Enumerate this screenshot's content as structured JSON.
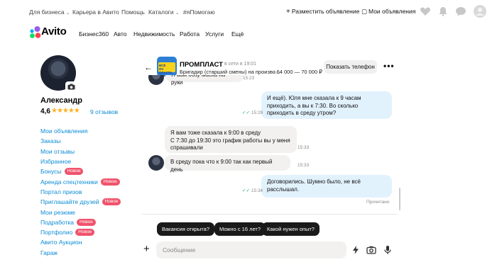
{
  "topbar": {
    "links": [
      "Для бизнеса",
      "Карьера в Авито",
      "Помощь",
      "Каталоги",
      "#яПомогаю"
    ],
    "post_ad": "Разместить объявление",
    "my_ads": "Мои объявления"
  },
  "header": {
    "logo_text": "Avito",
    "nav": [
      "Бизнес360",
      "Авто",
      "Недвижимость",
      "Работа",
      "Услуги",
      "Ещё"
    ]
  },
  "profile": {
    "name": "Александр",
    "rating": "4,6",
    "stars": "★★★★★",
    "rating_value": 4.6,
    "reviews": "9 отзывов",
    "menu": [
      {
        "label": "Мои объявления",
        "badge": ""
      },
      {
        "label": "Заказы",
        "badge": ""
      },
      {
        "label": "Мои отзывы",
        "badge": ""
      },
      {
        "label": "Избранное",
        "badge": ""
      },
      {
        "label": "Бонусы",
        "badge": "Новое"
      },
      {
        "label": "Аренда спецтехники",
        "badge": "Новое"
      },
      {
        "label": "Портал призов",
        "badge": ""
      },
      {
        "label": "Приглашайте друзей",
        "badge": "Новое"
      },
      {
        "label": "Мои резюме",
        "badge": ""
      },
      {
        "label": "Подработка",
        "badge": "Новое"
      },
      {
        "label": "Портфолио",
        "badge": "Новое"
      },
      {
        "label": "Авито Аукцион",
        "badge": ""
      },
      {
        "label": "Гараж",
        "badge": ""
      }
    ]
  },
  "chat": {
    "shop_name": "ПРОМПЛАСТ",
    "status": "в сети в 19:01",
    "job": "Бригадир (старший смены) на произво...",
    "salary": "· 64 000 — 70 000 ₽",
    "phone_button": "Показать телефон",
    "messages": [
      {
        "dir": "in",
        "text": "Я вам обзу маска на руки",
        "time": "15:23"
      },
      {
        "dir": "out",
        "text": "И ещё). Юля мне сказала к 9 часам приходить, а вы к 7:30. Во сколько приходить в среду утром?",
        "time": "15:29"
      },
      {
        "dir": "in",
        "text": "Я вам тоже сказала к 9:00 в среду\nС 7:30 до 19:30 это график работы вы у меня спрашивали",
        "time": "15:33"
      },
      {
        "dir": "in",
        "text": "В среду пока что к 9:00 так как первый день",
        "time": "15:33"
      },
      {
        "dir": "out",
        "text": "Договорились. Шумно было, не всё расслышал.",
        "time": "15:34"
      }
    ],
    "read_status": "Прочитано",
    "suggestions": [
      "Вакансия открыта?",
      "Можно с 16 лет?",
      "Какой нужен опыт?"
    ],
    "input_placeholder": "Сообщение"
  }
}
